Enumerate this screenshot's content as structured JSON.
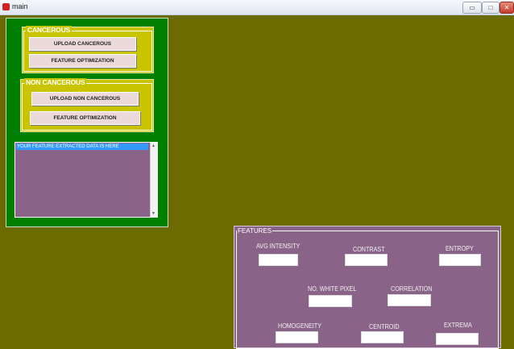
{
  "window": {
    "title": "main",
    "minimize_glyph": "▭",
    "maximize_glyph": "□",
    "close_glyph": "✕"
  },
  "cancerous": {
    "title": "CANCEROUS",
    "upload_label": "UPLOAD CANCEROUS",
    "optimize_label": "FEATURE OPTIMIZATION"
  },
  "non_cancerous": {
    "title": "NON CANCEROUS",
    "upload_label": "UPLOAD NON CANCEROUS",
    "optimize_label": "FEATURE OPTIMIZATION"
  },
  "listbox": {
    "items": [
      "YOUR FEATURE EXTRACTED DATA IS HERE"
    ]
  },
  "features": {
    "title": "FEATURES",
    "avg_intensity": {
      "label": "AVG INTENSITY",
      "value": ""
    },
    "contrast": {
      "label": "CONTRAST",
      "value": ""
    },
    "entropy": {
      "label": "ENTROPY",
      "value": ""
    },
    "white_pixel": {
      "label": "NO. WHITE PIXEL",
      "value": ""
    },
    "correlation": {
      "label": "CORRELATION",
      "value": ""
    },
    "homogeneity": {
      "label": "HOMOGENEITY",
      "value": ""
    },
    "centroid": {
      "label": "CENTROID",
      "value": ""
    },
    "extrema": {
      "label": "EXTREMA",
      "value": ""
    }
  },
  "colors": {
    "background": "#6b6b00",
    "panel": "#008000",
    "group": "#c9c400",
    "mauve": "#896488",
    "button": "#ecd9da",
    "selection": "#3399ff"
  }
}
